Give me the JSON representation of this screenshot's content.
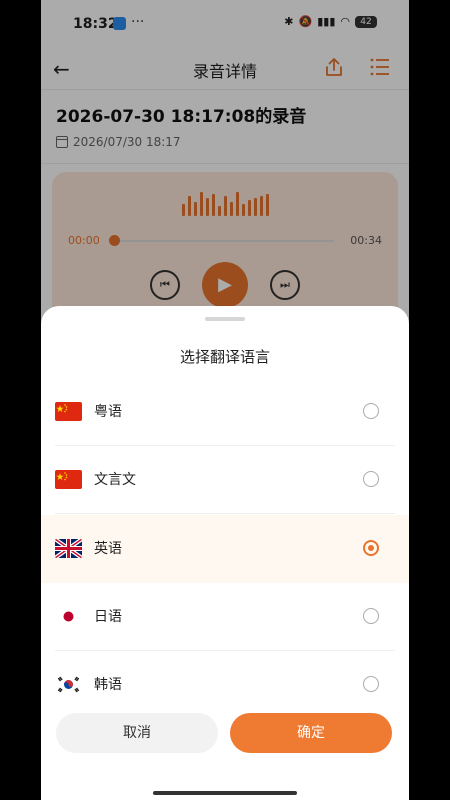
{
  "status_bar": {
    "time": "18:32",
    "dots": "···",
    "battery": "42"
  },
  "nav": {
    "title": "录音详情"
  },
  "recording": {
    "title": "2026-07-30 18:17:08的录音",
    "date": "2026/07/30 18:17"
  },
  "player": {
    "current_time": "00:00",
    "total_time": "00:34"
  },
  "sheet": {
    "title": "选择翻译语言",
    "languages": [
      {
        "label": "粤语",
        "flag": "china-flag-icon",
        "selected": false
      },
      {
        "label": "文言文",
        "flag": "china-flag-icon",
        "selected": false
      },
      {
        "label": "英语",
        "flag": "uk-flag-icon",
        "selected": true
      },
      {
        "label": "日语",
        "flag": "japan-flag-icon",
        "selected": false
      },
      {
        "label": "韩语",
        "flag": "korea-flag-icon",
        "selected": false
      }
    ],
    "cancel_label": "取消",
    "confirm_label": "确定"
  },
  "colors": {
    "accent": "#ef7a32",
    "selected_row_bg": "#fff8f1",
    "player_bg": "#fde8d8"
  }
}
